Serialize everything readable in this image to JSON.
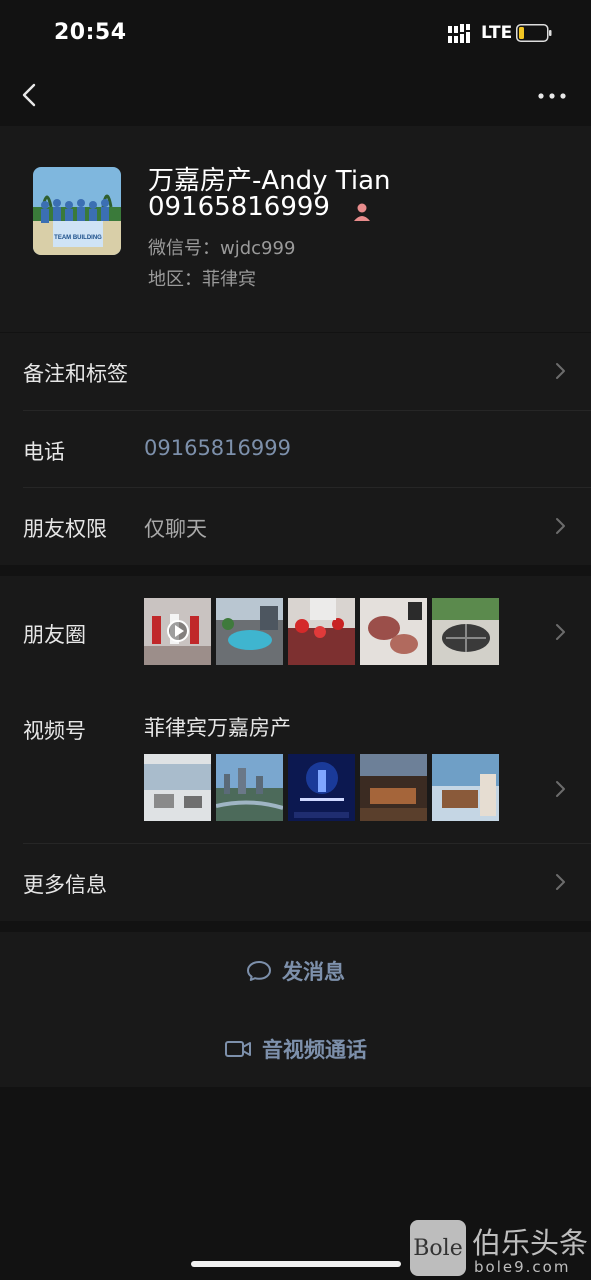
{
  "status_bar": {
    "time": "20:54",
    "network": "LTE",
    "signal_icon": "signal-bars-icon",
    "battery_icon": "battery-low-icon"
  },
  "nav": {
    "back_icon": "chevron-left-icon",
    "more_icon": "more-dots-icon"
  },
  "profile": {
    "name": "万嘉房产-Andy Tian",
    "phone_line": "09165816999",
    "wechat_id": "微信号：wjdc999",
    "region": "地区：菲律宾",
    "avatar_banner_text": "TEAM BUILDING",
    "gender_icon": "female-person-icon"
  },
  "rows": {
    "remark_label": "备注和标签",
    "phone_label": "电话",
    "phone_value": "09165816999",
    "permission_label": "朋友权限",
    "permission_value": "仅聊天",
    "moments_label": "朋友圈",
    "channels_label": "视频号",
    "channels_value": "菲律宾万嘉房产",
    "more_label": "更多信息"
  },
  "actions": {
    "message_label": "发消息",
    "message_icon": "chat-bubble-icon",
    "call_label": "音视频通话",
    "call_icon": "video-camera-icon"
  },
  "watermark": {
    "logo": "Bole",
    "title": "伯乐头条",
    "sub": "bole9.com"
  },
  "colors": {
    "background": "#121212",
    "card": "#191919",
    "link": "#7d90ab"
  }
}
